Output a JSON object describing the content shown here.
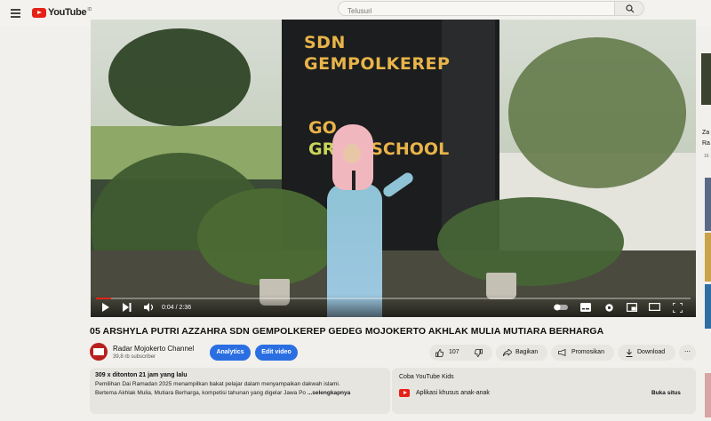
{
  "header": {
    "logo_text": "YouTube",
    "country_code": "ID",
    "search_placeholder": "Telusuri"
  },
  "player": {
    "wall_sign_line1": "SDN",
    "wall_sign_line2": "GEMPOLKEREP",
    "wall_sign_line3": "GO",
    "wall_sign_line4a": "GR",
    "wall_sign_line4b": "SCHOOL",
    "time_display": "0:04 / 2:36",
    "progress_fraction": 0.026,
    "accent_color": "#e62117"
  },
  "video": {
    "title": "05 ARSHYLA PUTRI AZZAHRA SDN GEMPOLKEREP GEDEG MOJOKERTO AKHLAK MULIA MUTIARA BERHARGA"
  },
  "channel": {
    "name": "Radar Mojokerto Channel",
    "subscribers": "39,8 rb subscriber"
  },
  "actions": {
    "analytics_label": "Analytics",
    "edit_video_label": "Edit video",
    "like_count": "107",
    "share_label": "Bagikan",
    "promote_label": "Promosikan",
    "download_label": "Download",
    "more_label": "⋯"
  },
  "description": {
    "views_date": "309 x ditonton  21 jam yang lalu",
    "line1": "Pemilihan Dai Ramadan 2025 menampilkan bakat pelajar dalam menyampaikan dakwah islami.",
    "line2": "Bertema Akhlak Mulia, Mutiara Berharga, kompetisi tahunan yang digelar Jawa Po",
    "more": "...selengkapnya"
  },
  "kids_panel": {
    "title": "Coba YouTube Kids",
    "label": "Aplikasi khusus anak-anak",
    "open_label": "Buka situs"
  },
  "sidebar": {
    "title_line1": "Za",
    "title_line2": "Ra",
    "meta": "16"
  }
}
